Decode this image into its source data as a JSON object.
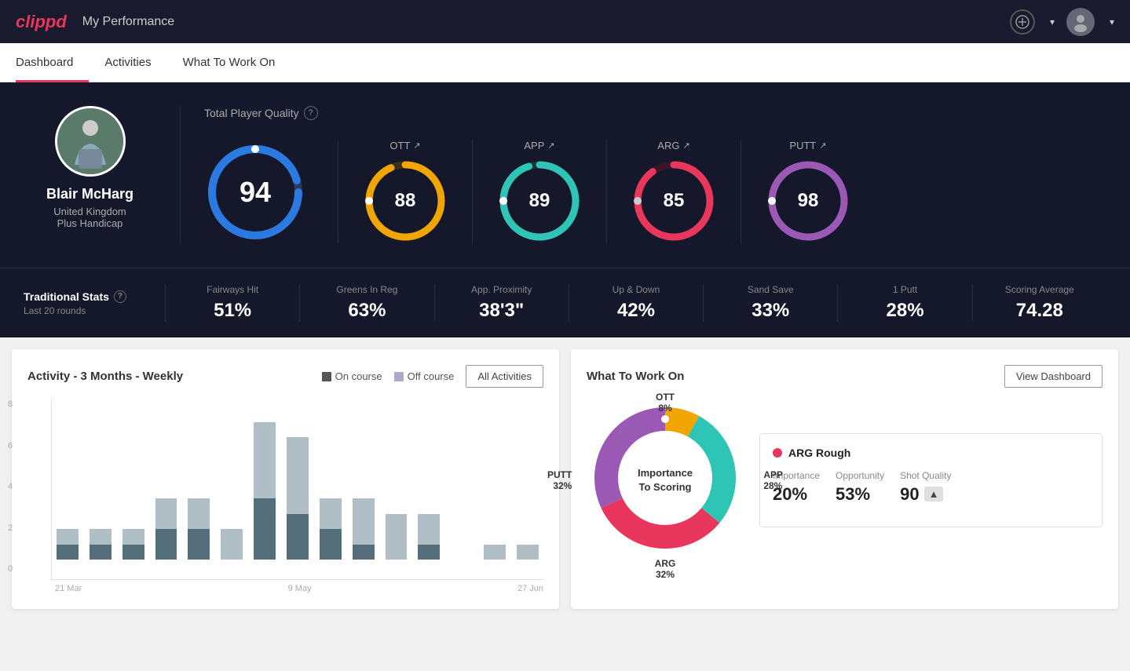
{
  "app": {
    "logo": "clippd",
    "header_title": "My Performance"
  },
  "nav": {
    "tabs": [
      {
        "label": "Dashboard",
        "active": true
      },
      {
        "label": "Activities",
        "active": false
      },
      {
        "label": "What To Work On",
        "active": false
      }
    ]
  },
  "player": {
    "name": "Blair McHarg",
    "country": "United Kingdom",
    "handicap": "Plus Handicap"
  },
  "total_quality": {
    "label": "Total Player Quality",
    "main_score": "94",
    "categories": [
      {
        "label": "OTT",
        "trend": "↗",
        "score": "88",
        "color": "#f0a500",
        "track_color": "#3a3a2a"
      },
      {
        "label": "APP",
        "trend": "↗",
        "score": "89",
        "color": "#2ec4b6",
        "track_color": "#1a3a3a"
      },
      {
        "label": "ARG",
        "trend": "↗",
        "score": "85",
        "color": "#e8365d",
        "track_color": "#3a1a2a"
      },
      {
        "label": "PUTT",
        "trend": "↗",
        "score": "98",
        "color": "#9b59b6",
        "track_color": "#2a1a3a"
      }
    ]
  },
  "traditional_stats": {
    "label": "Traditional Stats",
    "sub_label": "Last 20 rounds",
    "stats": [
      {
        "label": "Fairways Hit",
        "value": "51%"
      },
      {
        "label": "Greens In Reg",
        "value": "63%"
      },
      {
        "label": "App. Proximity",
        "value": "38'3\""
      },
      {
        "label": "Up & Down",
        "value": "42%"
      },
      {
        "label": "Sand Save",
        "value": "33%"
      },
      {
        "label": "1 Putt",
        "value": "28%"
      },
      {
        "label": "Scoring Average",
        "value": "74.28"
      }
    ]
  },
  "activity_chart": {
    "title": "Activity - 3 Months - Weekly",
    "legend": {
      "on_course": "On course",
      "off_course": "Off course"
    },
    "all_activities_btn": "All Activities",
    "y_labels": [
      "8",
      "6",
      "4",
      "2",
      "0"
    ],
    "x_labels": [
      "21 Mar",
      "9 May",
      "27 Jun"
    ],
    "bars": [
      {
        "on": 1,
        "off": 1
      },
      {
        "on": 1,
        "off": 1
      },
      {
        "on": 1,
        "off": 1
      },
      {
        "on": 2,
        "off": 2
      },
      {
        "on": 2,
        "off": 2
      },
      {
        "on": 0,
        "off": 2
      },
      {
        "on": 4,
        "off": 5
      },
      {
        "on": 3,
        "off": 5
      },
      {
        "on": 2,
        "off": 2
      },
      {
        "on": 1,
        "off": 3
      },
      {
        "on": 0,
        "off": 3
      },
      {
        "on": 1,
        "off": 2
      },
      {
        "on": 0,
        "off": 0
      },
      {
        "on": 0,
        "off": 1
      },
      {
        "on": 0,
        "off": 1
      }
    ]
  },
  "what_to_work_on": {
    "title": "What To Work On",
    "view_dashboard_btn": "View Dashboard",
    "donut_center": "Importance\nTo Scoring",
    "segments": [
      {
        "label": "OTT",
        "value": "8%",
        "color": "#f0a500"
      },
      {
        "label": "APP",
        "value": "28%",
        "color": "#2ec4b6"
      },
      {
        "label": "ARG",
        "value": "32%",
        "color": "#e8365d"
      },
      {
        "label": "PUTT",
        "value": "32%",
        "color": "#9b59b6"
      }
    ],
    "info_card": {
      "title": "ARG Rough",
      "metrics": [
        {
          "label": "Importance",
          "value": "20%"
        },
        {
          "label": "Opportunity",
          "value": "53%"
        },
        {
          "label": "Shot Quality",
          "value": "90"
        }
      ]
    }
  }
}
